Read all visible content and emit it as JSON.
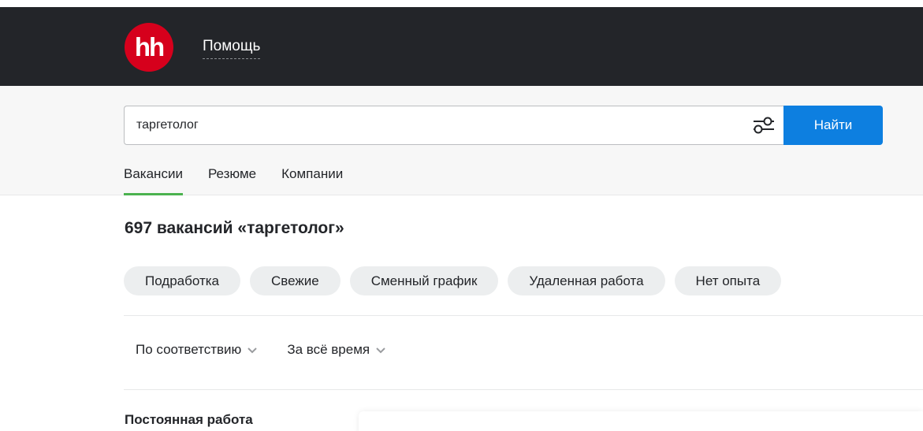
{
  "header": {
    "logo_text": "hh",
    "help_label": "Помощь",
    "logo_color": "#d6001c",
    "background": "#232529"
  },
  "search": {
    "value": "таргетолог",
    "filter_icon": "sliders-icon",
    "button_label": "Найти",
    "button_color": "#0d7fe0"
  },
  "tabs": [
    {
      "label": "Вакансии",
      "active": true
    },
    {
      "label": "Резюме",
      "active": false
    },
    {
      "label": "Компании",
      "active": false
    }
  ],
  "results": {
    "title": "697 вакансий «таргетолог»"
  },
  "chips": [
    {
      "label": "Подработка"
    },
    {
      "label": "Свежие"
    },
    {
      "label": "Сменный график"
    },
    {
      "label": "Удаленная работа"
    },
    {
      "label": "Нет опыта"
    }
  ],
  "sorts": [
    {
      "label": "По соответствию",
      "icon": "chevron-down-icon"
    },
    {
      "label": "За всё время",
      "icon": "chevron-down-icon"
    }
  ],
  "sidebar": {
    "section_label": "Постоянная работа"
  },
  "colors": {
    "active_tab_underline": "#4bb24e",
    "chip_background": "#eceeef"
  }
}
